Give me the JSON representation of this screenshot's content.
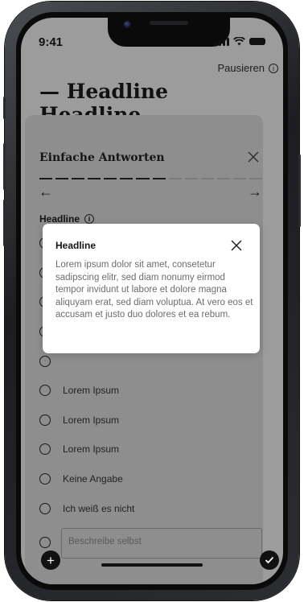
{
  "status_bar": {
    "time": "9:41"
  },
  "header": {
    "pause_label": "Pausieren",
    "headline": "— Headline Headline"
  },
  "question": {
    "title": "Einfache Antworten",
    "progress": {
      "completed": 8,
      "total": 14
    },
    "headline": "Headline",
    "options": [
      "Lorem Ipsum",
      "Lorem Ipsum",
      "Lorem Ipsum",
      "Keine Angabe",
      "Ich weiß es nicht"
    ],
    "describe_placeholder": "Beschreibe selbst"
  },
  "popup": {
    "title": "Headline",
    "body": "Lorem ipsum dolor sit amet, consetetur sadipscing elitr, sed diam nonumy eirmod tempor invidunt ut labore et dolore magna aliquyam erat, sed diam voluptua. At vero eos et accusam et justo duo dolores et ea rebum."
  },
  "colors": {
    "overlay": "#9c9c9c",
    "card": "#8e8e8e",
    "progress_done": "#1a1a1a",
    "progress_todo": "#7a7a7a"
  },
  "icons": {
    "add": "plus-icon",
    "done": "check-icon",
    "info": "info-icon",
    "close": "close-icon"
  }
}
